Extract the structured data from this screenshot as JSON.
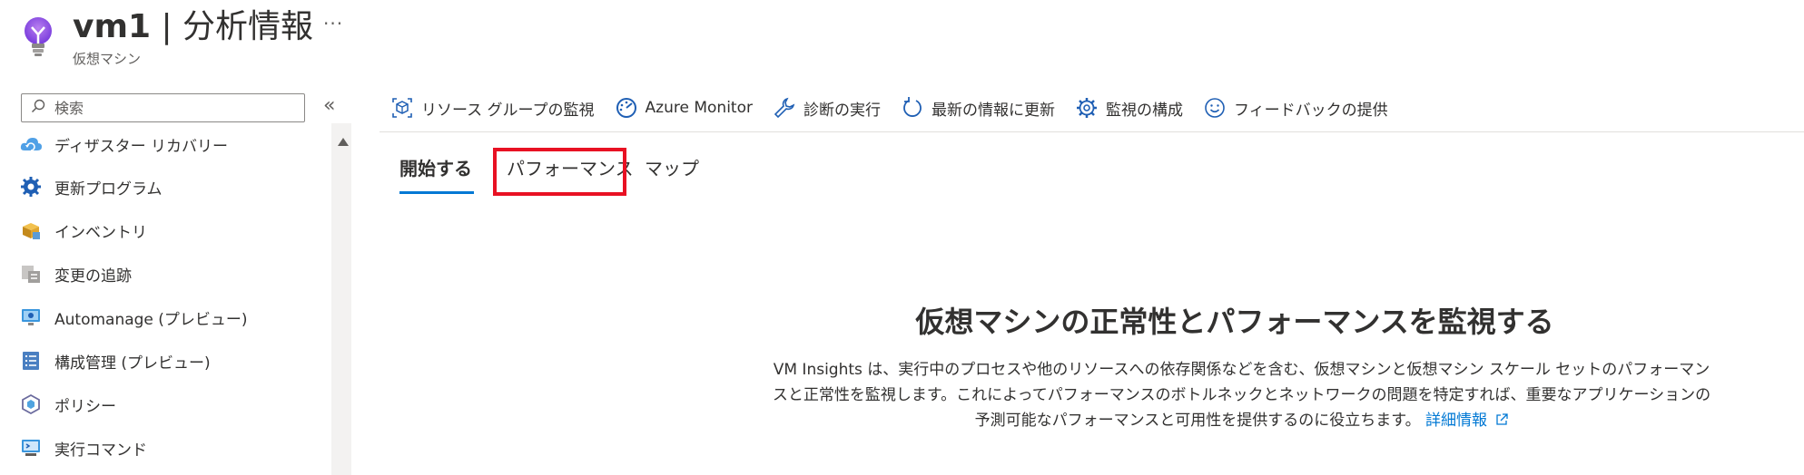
{
  "header": {
    "vm_name": "vm1",
    "separator": " | ",
    "page_name": "分析情報",
    "subtitle": "仮想マシン",
    "more": "···"
  },
  "sidebar": {
    "search_placeholder": "検索",
    "collapse": "«",
    "items": [
      {
        "label": "ディザスター リカバリー",
        "icon": "cloud-recovery-icon"
      },
      {
        "label": "更新プログラム",
        "icon": "gear-update-icon"
      },
      {
        "label": "インベントリ",
        "icon": "inventory-box-icon"
      },
      {
        "label": "変更の追跡",
        "icon": "change-tracking-icon"
      },
      {
        "label": "Automanage (プレビュー)",
        "icon": "automanage-monitor-icon"
      },
      {
        "label": "構成管理 (プレビュー)",
        "icon": "config-checklist-icon"
      },
      {
        "label": "ポリシー",
        "icon": "policy-hexagon-icon"
      },
      {
        "label": "実行コマンド",
        "icon": "run-command-icon"
      }
    ]
  },
  "toolbar": {
    "items": [
      {
        "label": "リソース グループの監視",
        "icon": "resource-group-icon"
      },
      {
        "label": "Azure Monitor",
        "icon": "azure-monitor-icon"
      },
      {
        "label": "診断の実行",
        "icon": "wrench-icon"
      },
      {
        "label": "最新の情報に更新",
        "icon": "refresh-icon"
      },
      {
        "label": "監視の構成",
        "icon": "gear-icon"
      },
      {
        "label": "フィードバックの提供",
        "icon": "smiley-icon"
      }
    ]
  },
  "tabs": [
    {
      "label": "開始する",
      "active": true
    },
    {
      "label": "パフォーマンス",
      "active": false
    },
    {
      "label": "マップ",
      "active": false
    }
  ],
  "main": {
    "heading": "仮想マシンの正常性とパフォーマンスを監視する",
    "description": "VM Insights は、実行中のプロセスや他のリソースへの依存関係などを含む、仮想マシンと仮想マシン スケール セットのパフォーマンスと正常性を監視します。これによってパフォーマンスのボトルネックとネットワークの問題を特定すれば、重要なアプリケーションの予測可能なパフォーマンスと可用性を提供するのに役立ちます。",
    "learn_more": "詳細情報"
  },
  "colors": {
    "accent": "#0078d4",
    "highlight": "#e81123",
    "text": "#323130"
  }
}
